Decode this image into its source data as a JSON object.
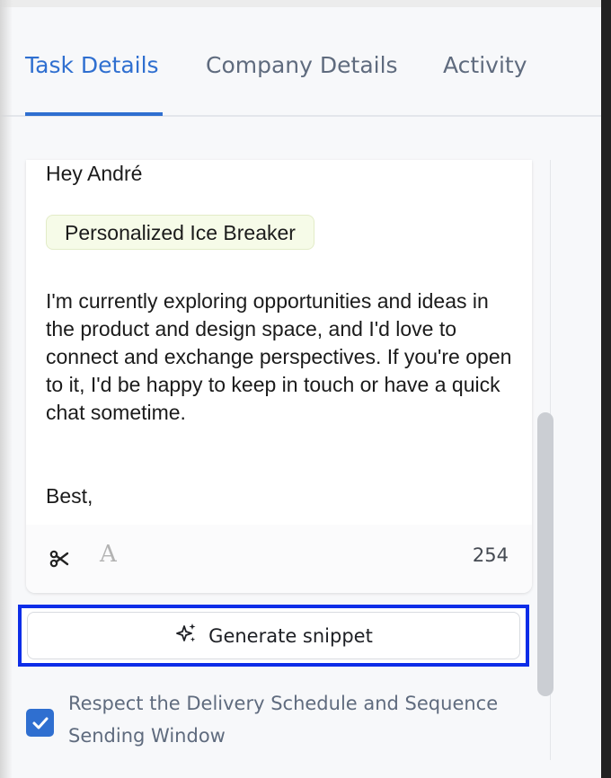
{
  "tabs": [
    {
      "label": "Task Details",
      "active": true
    },
    {
      "label": "Company Details",
      "active": false
    },
    {
      "label": "Activity",
      "active": false
    }
  ],
  "editor": {
    "greeting": "Hey André",
    "snippet_chip": "Personalized Ice Breaker",
    "body": "I'm currently exploring opportunities and ideas in the product and design space, and I'd love to connect and exchange perspectives. If you're open to it, I'd be happy to keep in touch or have a quick chat sometime.",
    "signoff": "Best,",
    "char_count": "254",
    "toolbar_icons": [
      "scissors-icon",
      "font-a-icon"
    ]
  },
  "generate_button": {
    "label": "Generate snippet",
    "icon": "sparkles-icon"
  },
  "respect_schedule": {
    "label": "Respect the Delivery Schedule and Sequence Sending Window",
    "checked": true
  },
  "colors": {
    "accent": "#2f6fd0",
    "highlight_border": "#0d2de8",
    "chip_background": "#f6fbe8",
    "muted_text": "#5f6b7e"
  }
}
